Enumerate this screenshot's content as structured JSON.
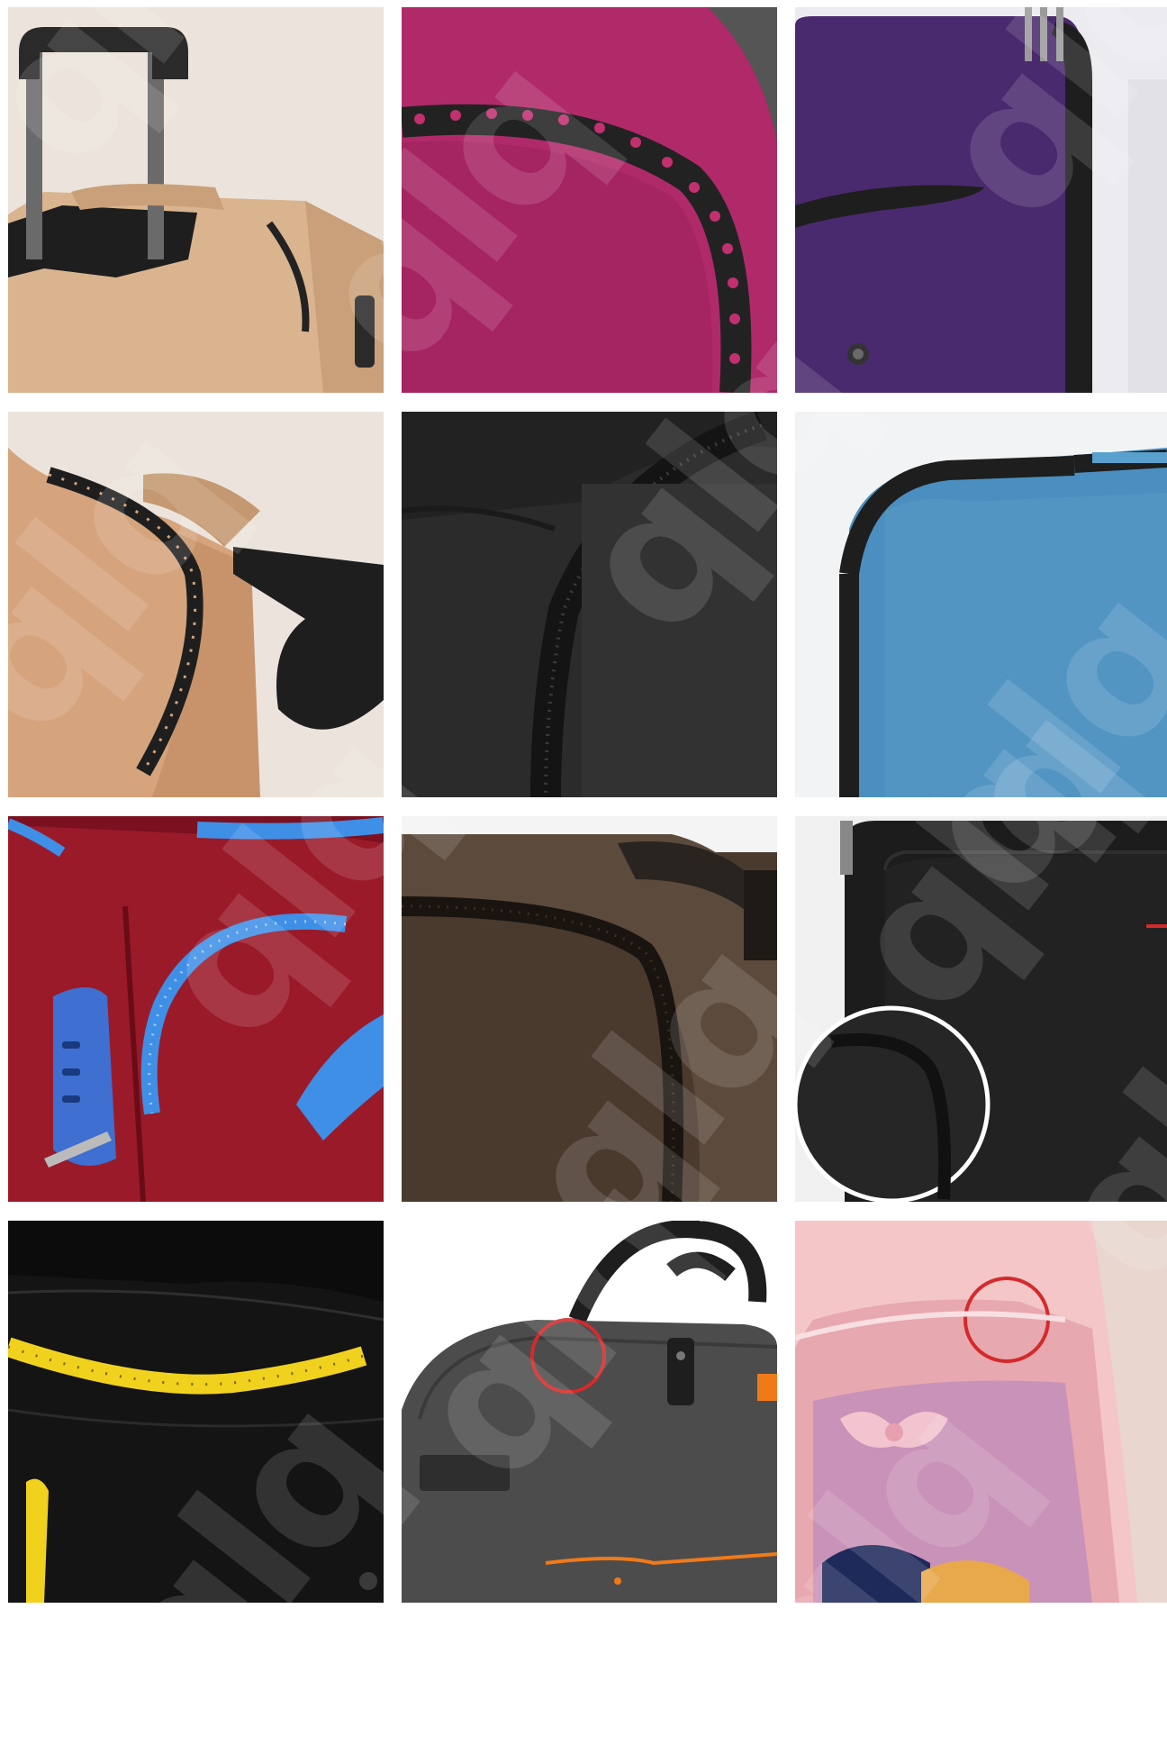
{
  "image": {
    "description_tiles": [
      {
        "id": "tan-suitcase-handle",
        "color": "#d9b48e"
      },
      {
        "id": "magenta-perforated-piping",
        "color": "#b02a6a"
      },
      {
        "id": "purple-suitcase-side",
        "color": "#4a2a6e"
      },
      {
        "id": "tan-suitcase-edge",
        "color": "#d6a47c"
      },
      {
        "id": "black-suitcase-piping",
        "color": "#2a2a2a"
      },
      {
        "id": "blue-denim-suitcase",
        "color": "#4a8fbf"
      },
      {
        "id": "red-suitcase-blue-piping",
        "color": "#9a1a2a"
      },
      {
        "id": "brown-suitcase-piping",
        "color": "#4a3a2e"
      },
      {
        "id": "black-suitcase-zoom-circle",
        "color": "#1c1c1c"
      },
      {
        "id": "black-bag-yellow-piping",
        "color": "#141414"
      },
      {
        "id": "grey-duffel-bag",
        "color": "#4c4c4c"
      },
      {
        "id": "pink-kids-backpack",
        "color": "#e8a8b0"
      }
    ],
    "watermark_text": "qlq",
    "accent_colors": {
      "highlight_circle": "#d42a2a",
      "zoom_ring": "#ffffff",
      "blue_piping": "#3f8fe6",
      "yellow_piping": "#f0d21e",
      "orange_trim": "#f07a1a"
    }
  }
}
